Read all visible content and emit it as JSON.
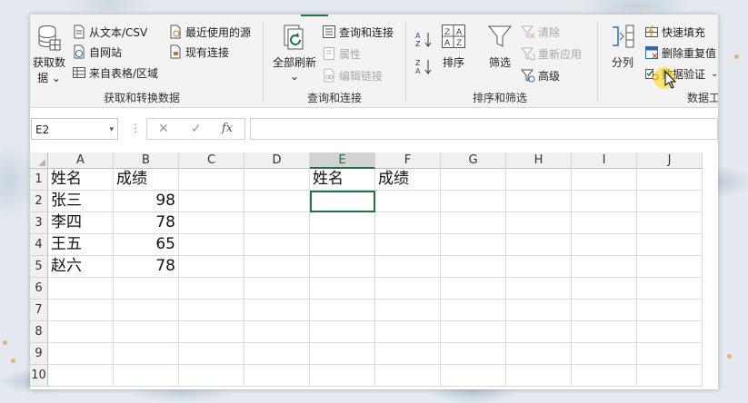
{
  "ribbon": {
    "get_data_label_1": "获取数",
    "get_data_label_2": "据 ⌄",
    "from_text_csv": "从文本/CSV",
    "from_web": "自网站",
    "from_table_range": "来自表格/区域",
    "recent_sources": "最近使用的源",
    "existing_connections": "现有连接",
    "group_get_transform": "获取和转换数据",
    "refresh_all_1": "全部刷新",
    "refresh_all_2": "⌄",
    "queries_connections": "查询和连接",
    "properties": "属性",
    "edit_links": "编辑链接",
    "group_queries": "查询和连接",
    "sort": "排序",
    "filter": "筛选",
    "clear": "清除",
    "reapply": "重新应用",
    "advanced": "高级",
    "group_sort_filter": "排序和筛选",
    "text_to_columns": "分列",
    "flash_fill": "快速填充",
    "remove_duplicates": "删除重复值",
    "data_validation": "数据验证",
    "data_validation_caret": "⌄",
    "group_data_tools": "数据工"
  },
  "formula_bar": {
    "name_box": "E2",
    "name_caret": "▾",
    "sep": "⋮",
    "cancel": "✕",
    "enter": "✓",
    "fx": "fx",
    "formula": ""
  },
  "columns": [
    "A",
    "B",
    "C",
    "D",
    "E",
    "F",
    "G",
    "H",
    "I",
    "J"
  ],
  "rows": [
    "1",
    "2",
    "3",
    "4",
    "5",
    "6",
    "7",
    "8",
    "9",
    "10"
  ],
  "cells": {
    "A1": "姓名",
    "B1": "成绩",
    "A2": "张三",
    "B2": "98",
    "A3": "李四",
    "B3": "78",
    "A4": "王五",
    "B4": "65",
    "A5": "赵六",
    "B5": "78",
    "E1": "姓名",
    "F1": "成绩"
  },
  "selected_cell": "E2",
  "colors": {
    "accent": "#217346",
    "ribbon_bg": "#f3f3f3"
  }
}
